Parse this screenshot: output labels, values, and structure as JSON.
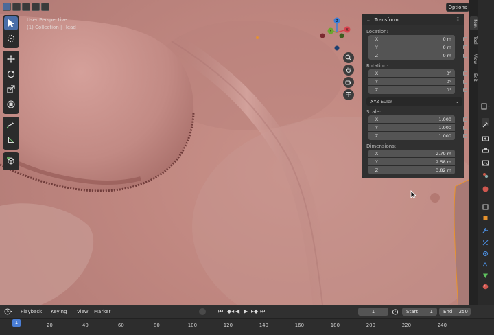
{
  "viewport": {
    "perspective_label": "User Perspective",
    "collection_label": "(1) Collection | Head",
    "options_label": "Options"
  },
  "transform": {
    "title": "Transform",
    "location_label": "Location:",
    "location": [
      {
        "axis": "X",
        "value": "0 m"
      },
      {
        "axis": "Y",
        "value": "0 m"
      },
      {
        "axis": "Z",
        "value": "0 m"
      }
    ],
    "rotation_label": "Rotation:",
    "rotation": [
      {
        "axis": "X",
        "value": "0°"
      },
      {
        "axis": "Y",
        "value": "0°"
      },
      {
        "axis": "Z",
        "value": "0°"
      }
    ],
    "rotation_mode": "XYZ Euler",
    "scale_label": "Scale:",
    "scale": [
      {
        "axis": "X",
        "value": "1.000"
      },
      {
        "axis": "Y",
        "value": "1.000"
      },
      {
        "axis": "Z",
        "value": "1.000"
      }
    ],
    "dimensions_label": "Dimensions:",
    "dimensions": [
      {
        "axis": "X",
        "value": "2.79 m"
      },
      {
        "axis": "Y",
        "value": "2.58 m"
      },
      {
        "axis": "Z",
        "value": "3.82 m"
      }
    ]
  },
  "sidebar_tabs": [
    "Item",
    "Tool",
    "View",
    "Edit"
  ],
  "gizmo": {
    "x": "X",
    "y": "Y",
    "z": "Z"
  },
  "timeline": {
    "menu": [
      "Playback",
      "Keying",
      "View",
      "Marker"
    ],
    "current_frame": "1",
    "start_label": "Start",
    "start_value": "1",
    "end_label": "End",
    "end_value": "250",
    "ticks": [
      "20",
      "40",
      "60",
      "80",
      "100",
      "120",
      "140",
      "160",
      "180",
      "200",
      "220",
      "240"
    ],
    "cursor_frame": "1"
  },
  "colors": {
    "accent_blue": "#4a7ed6",
    "selection_orange": "#e8932c",
    "axis_x": "#d9434f",
    "axis_y": "#6ba62e",
    "axis_z": "#3a7fd8"
  }
}
